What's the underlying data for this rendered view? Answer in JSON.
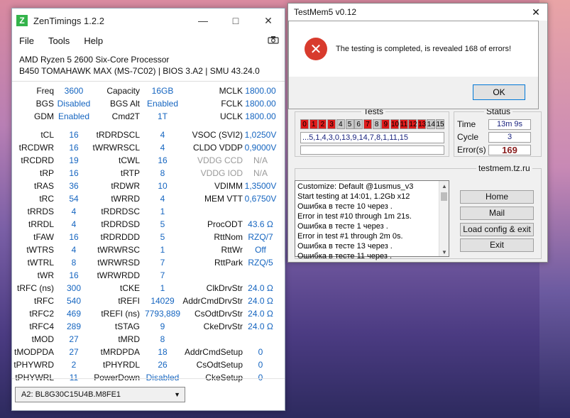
{
  "zentimings": {
    "title": "ZenTimings 1.2.2",
    "logo_letter": "Z",
    "menu": [
      "File",
      "Tools",
      "Help"
    ],
    "cpu_name": "AMD Ryzen 5 2600 Six-Core Processor",
    "board_info": "B450 TOMAHAWK MAX (MS-7C02) | BIOS 3.A2 | SMU 43.24.0",
    "rows": [
      [
        [
          "Freq",
          "3600"
        ],
        [
          "Capacity",
          "16GB"
        ],
        [
          "MCLK",
          "1800.00"
        ]
      ],
      [
        [
          "BGS",
          "Disabled"
        ],
        [
          "BGS Alt",
          "Enabled"
        ],
        [
          "FCLK",
          "1800.00"
        ]
      ],
      [
        [
          "GDM",
          "Enabled"
        ],
        [
          "Cmd2T",
          "1T"
        ],
        [
          "UCLK",
          "1800.00"
        ]
      ],
      [
        [
          "tCL",
          "16"
        ],
        [
          "tRDRDSCL",
          "4"
        ],
        [
          "VSOC (SVI2)",
          "1,0250V"
        ]
      ],
      [
        [
          "tRCDWR",
          "16"
        ],
        [
          "tWRWRSCL",
          "4"
        ],
        [
          "CLDO VDDP",
          "0,9000V"
        ]
      ],
      [
        [
          "tRCDRD",
          "19"
        ],
        [
          "tCWL",
          "16"
        ],
        [
          "VDDG CCD",
          "N/A"
        ]
      ],
      [
        [
          "tRP",
          "16"
        ],
        [
          "tRTP",
          "8"
        ],
        [
          "VDDG IOD",
          "N/A"
        ]
      ],
      [
        [
          "tRAS",
          "36"
        ],
        [
          "tRDWR",
          "10"
        ],
        [
          "VDIMM",
          "1,3500V"
        ]
      ],
      [
        [
          "tRC",
          "54"
        ],
        [
          "tWRRD",
          "4"
        ],
        [
          "MEM VTT",
          "0,6750V"
        ]
      ],
      [
        [
          "tRRDS",
          "4"
        ],
        [
          "tRDRDSC",
          "1"
        ],
        [
          "",
          ""
        ]
      ],
      [
        [
          "tRRDL",
          "4"
        ],
        [
          "tRDRDSD",
          "5"
        ],
        [
          "ProcODT",
          "43.6 Ω"
        ]
      ],
      [
        [
          "tFAW",
          "16"
        ],
        [
          "tRDRDDD",
          "5"
        ],
        [
          "RttNom",
          "RZQ/7"
        ]
      ],
      [
        [
          "tWTRS",
          "4"
        ],
        [
          "tWRWRSC",
          "1"
        ],
        [
          "RttWr",
          "Off"
        ]
      ],
      [
        [
          "tWTRL",
          "8"
        ],
        [
          "tWRWRSD",
          "7"
        ],
        [
          "RttPark",
          "RZQ/5"
        ]
      ],
      [
        [
          "tWR",
          "16"
        ],
        [
          "tWRWRDD",
          "7"
        ],
        [
          "",
          ""
        ]
      ],
      [
        [
          "tRFC (ns)",
          "300"
        ],
        [
          "tCKE",
          "1"
        ],
        [
          "ClkDrvStr",
          "24.0 Ω"
        ]
      ],
      [
        [
          "tRFC",
          "540"
        ],
        [
          "tREFI",
          "14029"
        ],
        [
          "AddrCmdDrvStr",
          "24.0 Ω"
        ]
      ],
      [
        [
          "tRFC2",
          "469"
        ],
        [
          "tREFI (ns)",
          "7793,889"
        ],
        [
          "CsOdtDrvStr",
          "24.0 Ω"
        ]
      ],
      [
        [
          "tRFC4",
          "289"
        ],
        [
          "tSTAG",
          "9"
        ],
        [
          "CkeDrvStr",
          "24.0 Ω"
        ]
      ],
      [
        [
          "tMOD",
          "27"
        ],
        [
          "tMRD",
          "8"
        ],
        [
          "",
          ""
        ]
      ],
      [
        [
          "tMODPDA",
          "27"
        ],
        [
          "tMRDPDA",
          "18"
        ],
        [
          "AddrCmdSetup",
          "0"
        ]
      ],
      [
        [
          "tPHYWRD",
          "2"
        ],
        [
          "tPHYRDL",
          "26"
        ],
        [
          "CsOdtSetup",
          "0"
        ]
      ],
      [
        [
          "tPHYWRL",
          "11"
        ],
        [
          "PowerDown",
          "Disabled"
        ],
        [
          "CkeSetup",
          "0"
        ]
      ]
    ],
    "dimm_selected": "A2: BL8G30C15U4B.M8FE1"
  },
  "testmem": {
    "title": "TestMem5 v0.12",
    "dialog_text": "The testing is completed, is revealed 168 of errors!",
    "ok_label": "OK",
    "tests_title": "Tests",
    "tests": [
      {
        "n": "0",
        "s": "red"
      },
      {
        "n": "1",
        "s": "red"
      },
      {
        "n": "2",
        "s": "red"
      },
      {
        "n": "3",
        "s": "red"
      },
      {
        "n": "4",
        "s": "gray"
      },
      {
        "n": "5",
        "s": "gray"
      },
      {
        "n": "6",
        "s": "gray"
      },
      {
        "n": "7",
        "s": "red"
      },
      {
        "n": "8",
        "s": "gray"
      },
      {
        "n": "9",
        "s": "red"
      },
      {
        "n": "10",
        "s": "red"
      },
      {
        "n": "11",
        "s": "red"
      },
      {
        "n": "12",
        "s": "red"
      },
      {
        "n": "13",
        "s": "red"
      },
      {
        "n": "14",
        "s": "gray"
      },
      {
        "n": "15",
        "s": "gray"
      }
    ],
    "sequence": "...5,1,4,3,0,13,9,14,7,8,1,11,15",
    "status_title": "Status",
    "time_label": "Time",
    "time_value": "13m 9s",
    "cycle_label": "Cycle",
    "cycle_value": "3",
    "errors_label": "Error(s)",
    "errors_value": "169",
    "site_title": "testmem.tz.ru",
    "log": [
      "Customize: Default @1usmus_v3",
      "Start testing at 14:01, 1.2Gb x12",
      "Ошибка в тесте 10 через .",
      "Error in test #10 through 1m 21s.",
      "Ошибка в тесте 1 через .",
      "Error in test #1 through 2m 0s.",
      "Ошибка в тесте 13 через .",
      "Ошибка в тесте 11 через ."
    ],
    "buttons": [
      "Home",
      "Mail",
      "Load config & exit",
      "Exit"
    ]
  }
}
